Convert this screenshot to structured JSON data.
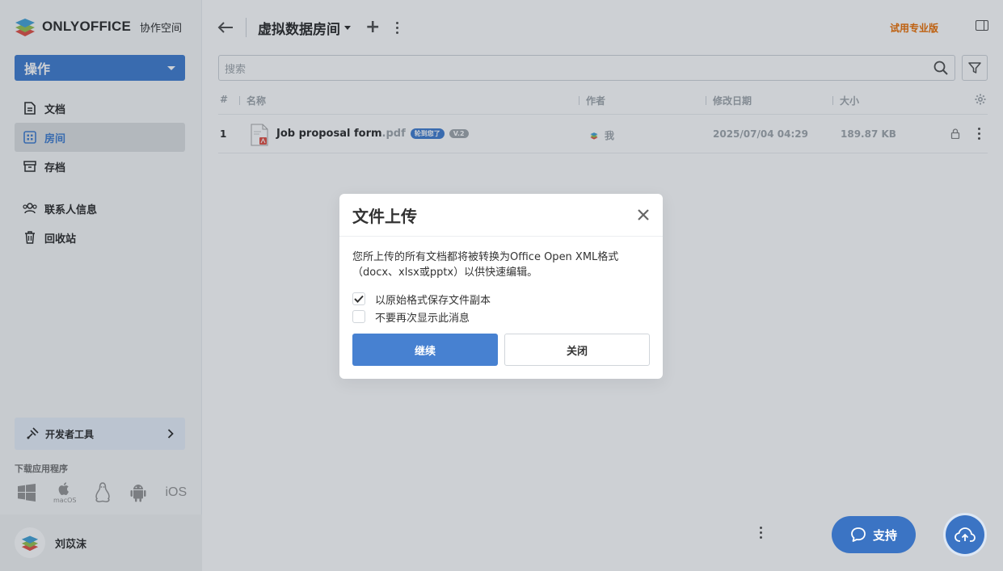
{
  "sidebar": {
    "logo_text": "ONLYOFFICE",
    "logo_sub": "协作空间",
    "action_label": "操作",
    "nav": [
      {
        "label": "文档",
        "icon": "document-icon"
      },
      {
        "label": "房间",
        "icon": "rooms-icon"
      },
      {
        "label": "存档",
        "icon": "archive-icon"
      },
      {
        "label": "联系人信息",
        "icon": "contacts-icon"
      },
      {
        "label": "回收站",
        "icon": "trash-icon"
      }
    ],
    "dev_tools_label": "开发者工具",
    "download_title": "下载应用程序",
    "download_apps": [
      "windows-icon",
      "macos-icon",
      "linux-icon",
      "android-icon",
      "ios-icon"
    ],
    "macos_caption": "macOS",
    "ios_caption": "iOS",
    "user_name": "刘苡沫"
  },
  "header": {
    "room_title": "虚拟数据房间",
    "trial_label": "试用专业版"
  },
  "search": {
    "placeholder": "搜索"
  },
  "table": {
    "columns": {
      "num": "#",
      "name": "名称",
      "author": "作者",
      "modified": "修改日期",
      "size": "大小"
    },
    "rows": [
      {
        "num": "1",
        "name": "Job proposal form",
        "ext": ".pdf",
        "badge_status": "轮到您了",
        "badge_version": "V.2",
        "author": "我",
        "modified": "2025/07/04 04:29",
        "size": "189.87 KB"
      }
    ]
  },
  "dialog": {
    "title": "文件上传",
    "message": "您所上传的所有文档都将被转换为Office Open XML格式（docx、xlsx或pptx）以供快速编辑。",
    "checkbox_keep": {
      "label": "以原始格式保存文件副本",
      "checked": true
    },
    "checkbox_dont_show": {
      "label": "不要再次显示此消息",
      "checked": false
    },
    "continue_label": "继续",
    "close_label": "关闭"
  },
  "floating": {
    "support_label": "支持"
  },
  "colors": {
    "accent": "#4781d1",
    "trial": "#ed7309"
  }
}
